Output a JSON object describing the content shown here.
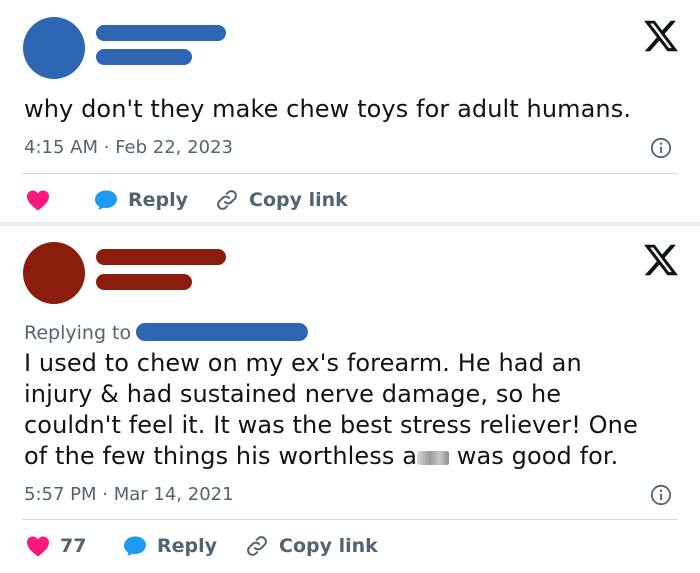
{
  "tweets": [
    {
      "avatar_color": "#2f66b3",
      "text": "why don't they make chew toys for adult humans.",
      "time": "4:15 AM",
      "date": "Feb 22, 2023",
      "like_count": "",
      "reply_label": "Reply",
      "copy_label": "Copy link"
    },
    {
      "avatar_color": "#8b1d0c",
      "replying_to_label": "Replying to",
      "text_line1": "I used to chew on my ex's forearm. He had an",
      "text_line2": "injury & had sustained nerve damage, so he",
      "text_line3": "couldn't feel it. It was the best stress reliever! One",
      "text_line4_a": "of the few things his worthless a",
      "text_line4_b": " was good for.",
      "time": "5:57 PM",
      "date": "Mar 14, 2021",
      "like_count": "77",
      "reply_label": "Reply",
      "copy_label": "Copy link"
    }
  ],
  "colors": {
    "heart": "#f91880",
    "bubble": "#1d9bf0",
    "muted": "#536471",
    "user1": "#2f66b3",
    "user2": "#8b1d0c"
  },
  "icons": [
    "x-logo-icon",
    "info-icon",
    "heart-icon",
    "reply-bubble-icon",
    "link-icon"
  ]
}
